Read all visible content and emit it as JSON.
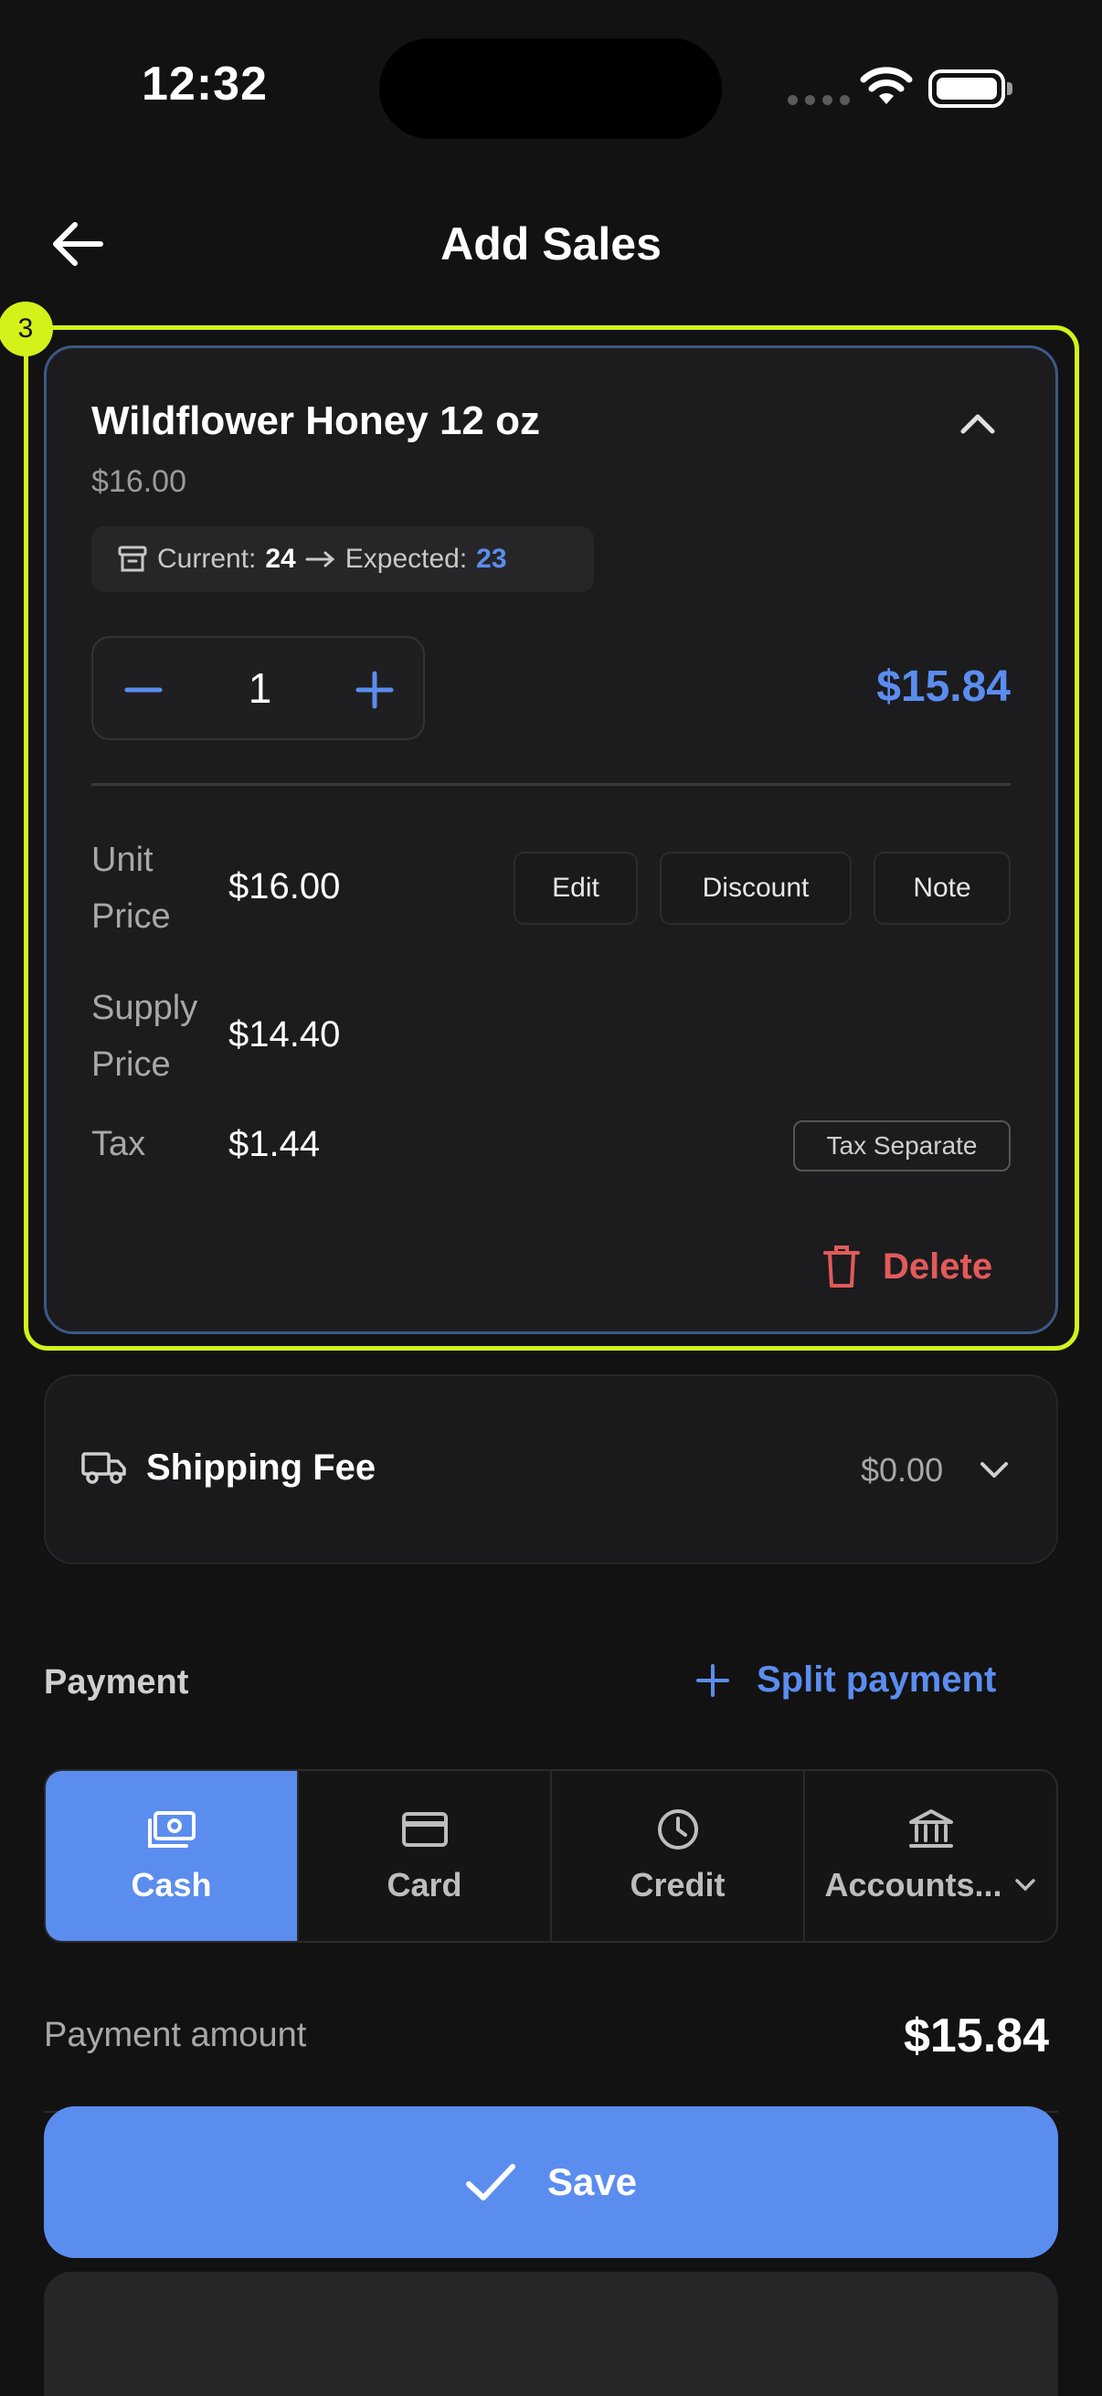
{
  "status": {
    "time": "12:32"
  },
  "header": {
    "title": "Add Sales"
  },
  "highlight": {
    "badge": "3"
  },
  "product": {
    "name": "Wildflower Honey 12 oz",
    "price": "$16.00",
    "stock": {
      "current_label": "Current:",
      "current": "24",
      "expected_label": "Expected:",
      "expected": "23"
    },
    "quantity": "1",
    "line_total": "$15.84",
    "unit_price_label": "Unit Price",
    "unit_price": "$16.00",
    "supply_price_label": "Supply Price",
    "supply_price": "$14.40",
    "tax_label": "Tax",
    "tax": "$1.44",
    "tax_mode": "Tax Separate",
    "actions": {
      "edit": "Edit",
      "discount": "Discount",
      "note": "Note"
    },
    "delete_label": "Delete"
  },
  "shipping": {
    "label": "Shipping Fee",
    "amount": "$0.00"
  },
  "payment": {
    "title": "Payment",
    "split_label": "Split payment",
    "methods": [
      {
        "label": "Cash",
        "icon": "cash-icon",
        "active": true
      },
      {
        "label": "Card",
        "icon": "card-icon",
        "active": false
      },
      {
        "label": "Credit",
        "icon": "clock-icon",
        "active": false
      },
      {
        "label": "Accounts...",
        "icon": "bank-icon",
        "active": false
      }
    ],
    "amount_label": "Payment amount",
    "amount": "$15.84"
  },
  "save_label": "Save",
  "colors": {
    "accent": "#5b8def",
    "danger": "#e35a5a",
    "highlight": "#d4f21a",
    "background": "#121212"
  }
}
